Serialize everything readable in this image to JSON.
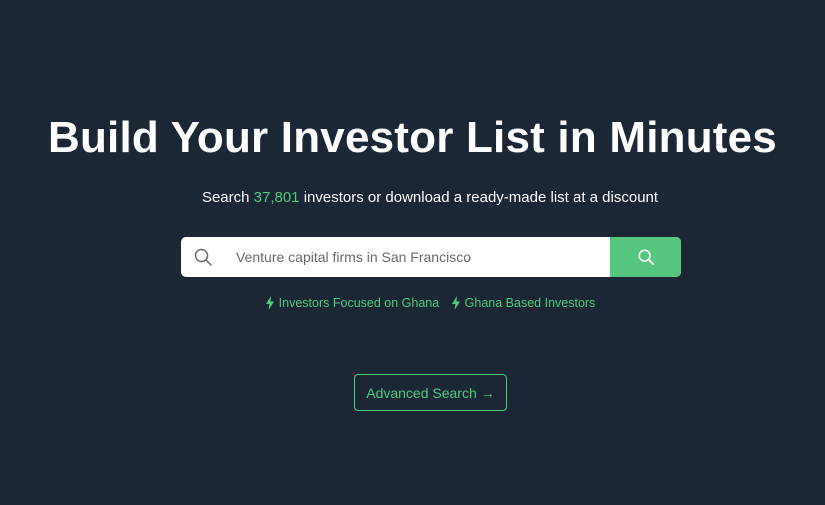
{
  "hero": {
    "title": "Build Your Investor List in Minutes",
    "subtitle_prefix": "Search ",
    "investor_count": "37,801",
    "subtitle_suffix": " investors or download a ready-made list at a discount"
  },
  "search": {
    "placeholder": "Venture capital firms in San Francisco",
    "value": ""
  },
  "quick_links": [
    {
      "label": "Investors Focused on Ghana",
      "icon": "bolt-icon"
    },
    {
      "label": "Ghana Based Investors",
      "icon": "bolt-icon"
    }
  ],
  "advanced_search": {
    "label": "Advanced Search",
    "arrow": "→"
  },
  "colors": {
    "background": "#1c2735",
    "accent": "#4ecb7b",
    "search_button": "#55c57f"
  }
}
